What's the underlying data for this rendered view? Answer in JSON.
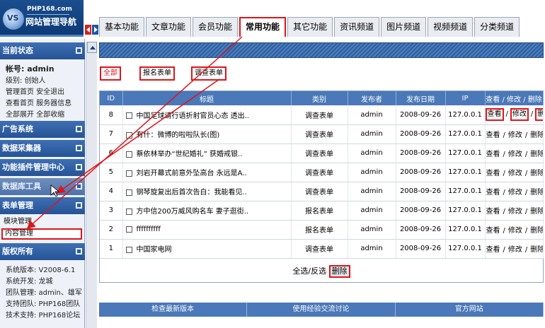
{
  "logo": {
    "site": "PHP168.com",
    "brand": "网站管理导航",
    "mark": "VS"
  },
  "tabs": [
    {
      "label": "基本功能",
      "active": false
    },
    {
      "label": "文章功能",
      "active": false
    },
    {
      "label": "会员功能",
      "active": false
    },
    {
      "label": "常用功能",
      "active": true
    },
    {
      "label": "其它功能",
      "active": false
    },
    {
      "label": "资讯频道",
      "active": false
    },
    {
      "label": "图片频道",
      "active": false
    },
    {
      "label": "视频频道",
      "active": false
    },
    {
      "label": "分类频道",
      "active": false
    }
  ],
  "sidebar": {
    "status_title": "当前状态",
    "account": "帐号: admin",
    "level": "级别: 创始人",
    "links1": "管理首页 安全退出",
    "links2": "查看首页 服务器信息",
    "links3": "全部展开 全部收缩",
    "sections": [
      "广告系统",
      "数据采集器",
      "功能插件管理中心",
      "数据库工具",
      "表单管理"
    ],
    "form_items": [
      "模块管理",
      "内容管理"
    ],
    "copyright_title": "版权所有",
    "info": [
      "系统版本: V2008-6.1",
      "系统开发: 龙城",
      "团队管理: admin、雄军",
      "支持团队: PHP168团队",
      "技术支持: PHP168论坛"
    ]
  },
  "filters": [
    "全部",
    "报名表单",
    "调查表单"
  ],
  "table": {
    "headers": [
      "ID",
      "标题",
      "类别",
      "发布者",
      "发布日期",
      "IP",
      "查看 / 修改 / 删除"
    ],
    "actions": [
      "查看",
      "修改",
      "删除"
    ],
    "rows": [
      {
        "id": "8",
        "title": "中国足球请行语折射官员心态 透出..",
        "type": "调查表单",
        "author": "admin",
        "date": "2008-09-26",
        "ip": "127.0.0.1"
      },
      {
        "id": "7",
        "title": "有什：微博的啦啦队长(图)",
        "type": "调查表单",
        "author": "admin",
        "date": "2008-09-26",
        "ip": "127.0.0.1"
      },
      {
        "id": "6",
        "title": "蔡依林举办“世纪婚礼” 获婚戒银..",
        "type": "调查表单",
        "author": "admin",
        "date": "2008-09-26",
        "ip": "127.0.0.1"
      },
      {
        "id": "5",
        "title": "刘岩开幕式前意外坠高台 永远是A..",
        "type": "调查表单",
        "author": "admin",
        "date": "2008-09-26",
        "ip": "127.0.0.1"
      },
      {
        "id": "4",
        "title": "钢琴旋复出后首次告白：我能看见..",
        "type": "调查表单",
        "author": "admin",
        "date": "2008-09-26",
        "ip": "127.0.0.1"
      },
      {
        "id": "3",
        "title": "方中信200万威风购名车 妻子逛街..",
        "type": "报名表单",
        "author": "admin",
        "date": "2008-09-26",
        "ip": "127.0.0.1"
      },
      {
        "id": "2",
        "title": "ffffffffff",
        "type": "报名表单",
        "author": "admin",
        "date": "2008-09-26",
        "ip": "127.0.0.1"
      },
      {
        "id": "1",
        "title": "中国家电网",
        "type": "调查表单",
        "author": "admin",
        "date": "2008-09-26",
        "ip": "127.0.0.1"
      }
    ],
    "select_all": "全选/反选",
    "delete_label": "删除"
  },
  "bottom": [
    "检查最新版本",
    "使用经验交流讨论",
    "官方网站"
  ],
  "colors": {
    "highlight": "#e0141a",
    "header": "#4a78b8",
    "nav": "#255396"
  }
}
